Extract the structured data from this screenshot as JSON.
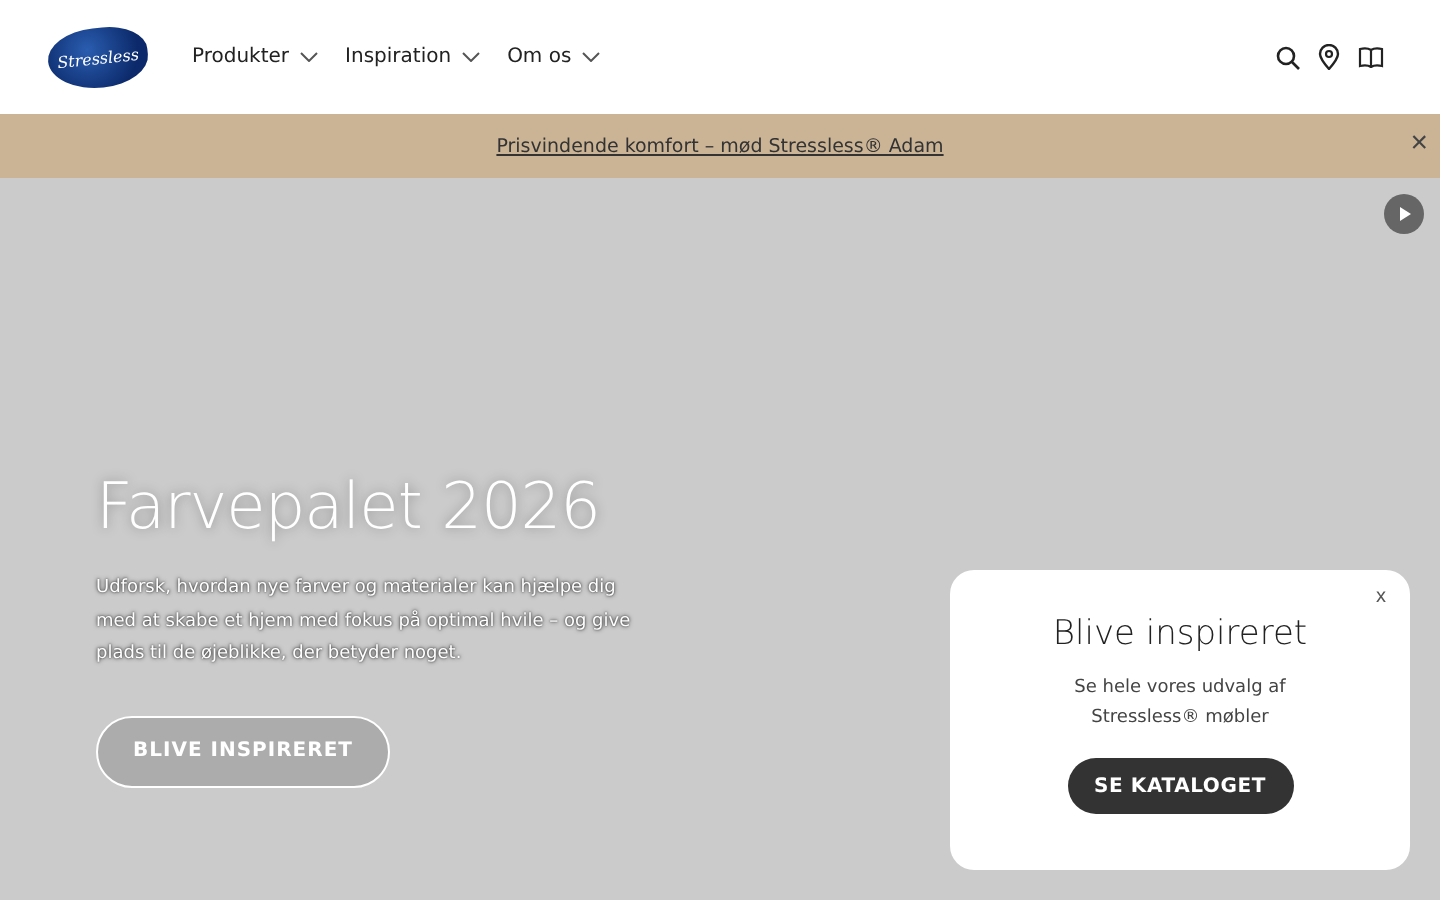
{
  "header": {
    "logo": "Stressless",
    "nav": [
      {
        "label": "Produkter"
      },
      {
        "label": "Inspiration"
      },
      {
        "label": "Om os"
      }
    ]
  },
  "banner": {
    "link": "Prisvindende komfort – mød Stressless® Adam",
    "close": "×"
  },
  "hero": {
    "title": "Farvepalet 2026",
    "text": "Udforsk, hvordan nye farver og materialer kan hjælpe dig med at skabe et hjem med fokus på optimal hvile – og give plads til de øjeblikke, der betyder noget.",
    "button": "BLIVE INSPIRERET"
  },
  "popup": {
    "close": "x",
    "title": "Blive inspireret",
    "text": "Se hele vores udvalg af Stressless® møbler",
    "button": "SE KATALOGET"
  }
}
